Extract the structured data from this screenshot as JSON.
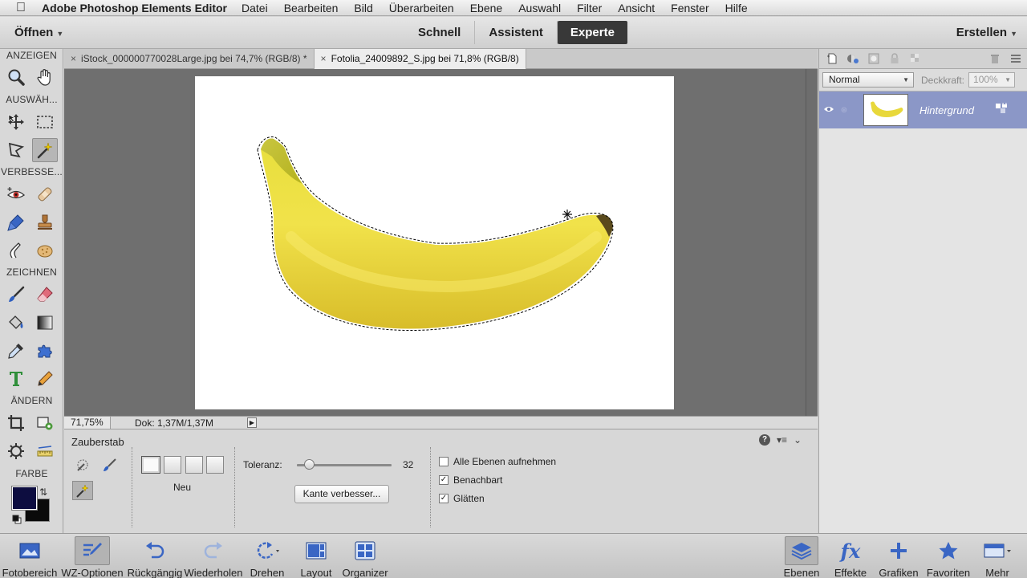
{
  "menubar": {
    "app_name": "Adobe Photoshop Elements Editor",
    "items": [
      "Datei",
      "Bearbeiten",
      "Bild",
      "Überarbeiten",
      "Ebene",
      "Auswahl",
      "Filter",
      "Ansicht",
      "Fenster",
      "Hilfe"
    ]
  },
  "topbar": {
    "open_label": "Öffnen",
    "modes": [
      "Schnell",
      "Assistent",
      "Experte"
    ],
    "active_mode": "Experte",
    "create_label": "Erstellen"
  },
  "toolbox": {
    "sections": {
      "view": "ANZEIGEN",
      "select": "AUSWÄH...",
      "enhance": "VERBESSE...",
      "draw": "ZEICHNEN",
      "modify": "ÄNDERN",
      "color": "FARBE"
    },
    "foreground_color": "#0d0d40",
    "background_color": "#0a0a0a"
  },
  "tabs": [
    {
      "label": "iStock_000000770028Large.jpg bei 74,7% (RGB/8) *",
      "active": false
    },
    {
      "label": "Fotolia_24009892_S.jpg bei 71,8% (RGB/8)",
      "active": true
    }
  ],
  "statusbar": {
    "zoom": "71,75%",
    "doc_size": "Dok: 1,37M/1,37M"
  },
  "tool_options": {
    "tool_name": "Zauberstab",
    "selection_mode_label": "Neu",
    "tolerance_label": "Toleranz:",
    "tolerance_value": "32",
    "tolerance_fraction": 0.125,
    "refine_edge_label": "Kante verbesser...",
    "checkboxes": [
      {
        "label": "Alle Ebenen aufnehmen",
        "checked": false
      },
      {
        "label": "Benachbart",
        "checked": true
      },
      {
        "label": "Glätten",
        "checked": true
      }
    ]
  },
  "layers_panel": {
    "blend_mode": "Normal",
    "opacity_label": "Deckkraft:",
    "opacity_value": "100%",
    "layers": [
      {
        "name": "Hintergrund",
        "visible": true,
        "selected": true
      }
    ],
    "selected_color": "#8b97c7"
  },
  "taskbar": {
    "left": [
      "Fotobereich",
      "WZ-Optionen",
      "Rückgängig",
      "Wiederholen",
      "Drehen",
      "Layout",
      "Organizer"
    ],
    "right": [
      "Ebenen",
      "Effekte",
      "Grafiken",
      "Favoriten",
      "Mehr"
    ]
  }
}
